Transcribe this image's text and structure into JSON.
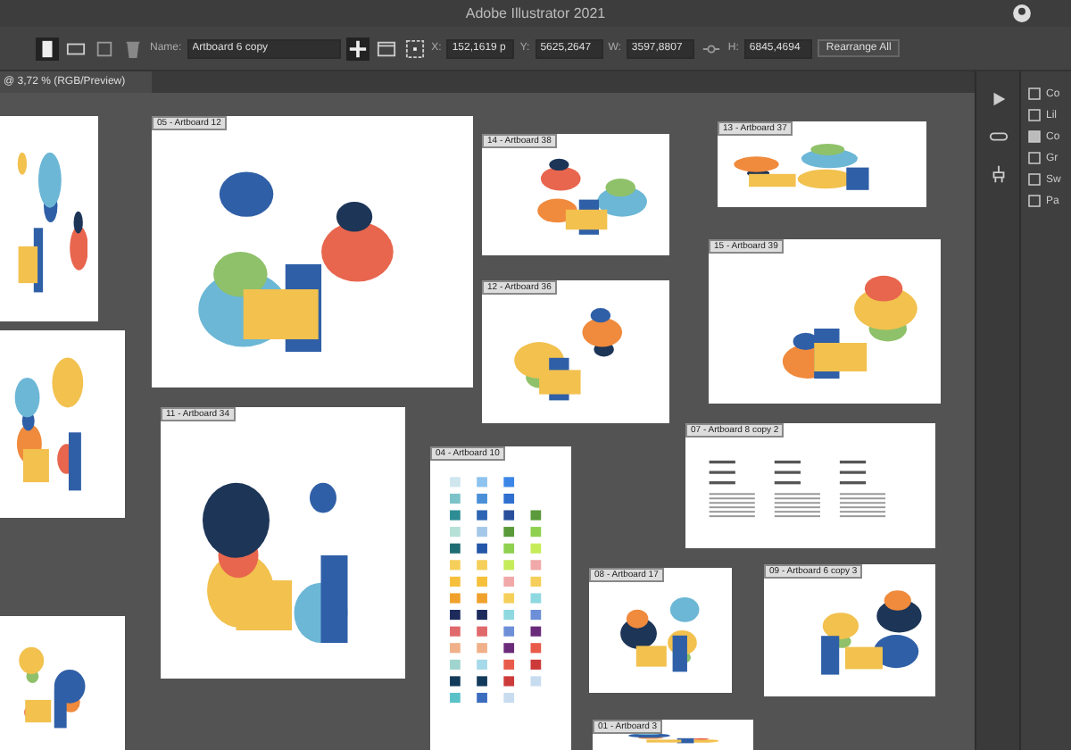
{
  "window": {
    "title": "Adobe Illustrator 2021"
  },
  "control_bar": {
    "name_label": "Name:",
    "name_value": "Artboard 6 copy",
    "x_label": "X:",
    "x_value": "152,1619 p",
    "y_label": "Y:",
    "y_value": "5625,2647",
    "w_label": "W:",
    "w_value": "3597,8807",
    "h_label": "H:",
    "h_value": "6845,4694",
    "rearrange_button": "Rearrange All"
  },
  "document_tab": {
    "title": "@ 3,72 % (RGB/Preview)"
  },
  "panels": [
    {
      "label": "Co"
    },
    {
      "label": "Lil"
    },
    {
      "label": "Co"
    },
    {
      "label": "Gr"
    },
    {
      "label": "Sw"
    },
    {
      "label": "Pa"
    }
  ],
  "artboards": [
    {
      "kind": "illustration"
    },
    {
      "label": "05 - Artboard 12",
      "kind": "illustration"
    },
    {
      "label": "14 - Artboard 38",
      "kind": "illustration"
    },
    {
      "label": "13 - Artboard 37",
      "kind": "illustration"
    },
    {
      "label": "12 - Artboard 36",
      "kind": "illustration"
    },
    {
      "label": "15 - Artboard 39",
      "kind": "illustration"
    },
    {
      "kind": "illustration"
    },
    {
      "label": "11 - Artboard 34",
      "kind": "illustration"
    },
    {
      "label": "04 - Artboard 10",
      "kind": "swatches"
    },
    {
      "label": "07 - Artboard 8 copy 2",
      "kind": "text"
    },
    {
      "label": "08 - Artboard 17",
      "kind": "illustration"
    },
    {
      "label": "09 - Artboard 6 copy 3",
      "kind": "illustration"
    },
    {
      "kind": "illustration"
    },
    {
      "label": "01 - Artboard 3",
      "kind": "illustration"
    }
  ]
}
